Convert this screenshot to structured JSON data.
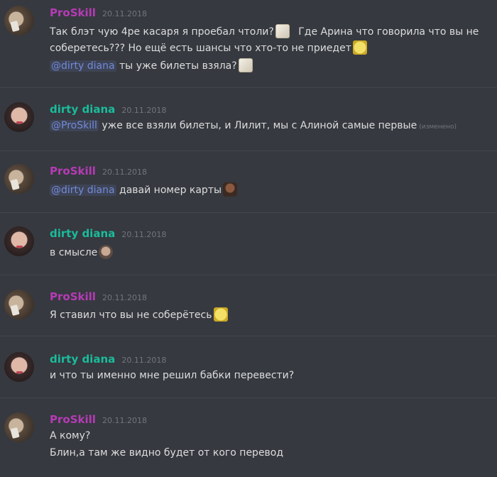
{
  "messages": [
    {
      "author": "ProSkill",
      "time": "20.11.2018",
      "lines": [
        "Так блэт чую 4ре касаря я проебал чтоли?",
        "Где Арина что говорила что вы не",
        "соберетесь??? Но ещё есть шансы что хто-то не приедет"
      ],
      "mention": "@dirty diana",
      "mention_text": "ты уже билеты взяла?"
    },
    {
      "author": "dirty diana",
      "time": "20.11.2018",
      "mention": "@ProSkill",
      "text": "уже все взяли билеты, и Лилит, мы с Алиной самые первые",
      "edited": "(изменено)"
    },
    {
      "author": "ProSkill",
      "time": "20.11.2018",
      "mention": "@dirty diana",
      "text": "давай номер карты"
    },
    {
      "author": "dirty diana",
      "time": "20.11.2018",
      "text": "в смысле"
    },
    {
      "author": "ProSkill",
      "time": "20.11.2018",
      "text": "Я ставил что вы не соберётесь"
    },
    {
      "author": "dirty diana",
      "time": "20.11.2018",
      "text": "и что ты именно мне решил бабки перевести?"
    },
    {
      "author": "ProSkill",
      "time": "20.11.2018",
      "lines": [
        "А кому?",
        "Блин,а там же видно будет от кого перевод"
      ]
    }
  ],
  "colors": {
    "background": "#36393f",
    "proskill": "#b63bb6",
    "dirty_diana": "#1abc9c",
    "mention": "#7289da"
  },
  "icons": {
    "dog": "doge-emoji",
    "sponge": "spongebob-emoji",
    "man": "man-face-emoji",
    "face": "face-emoji"
  }
}
